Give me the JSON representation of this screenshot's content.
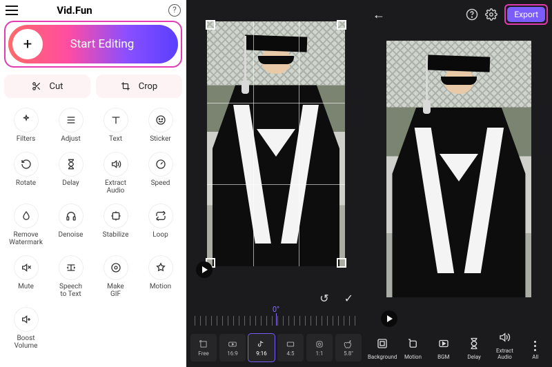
{
  "home": {
    "brand": "Vid.Fun",
    "start_label": "Start Editing",
    "cut_label": "Cut",
    "crop_label": "Crop",
    "tools": [
      {
        "id": "filters",
        "label": "Filters",
        "icon": "sparkle"
      },
      {
        "id": "adjust",
        "label": "Adjust",
        "icon": "sliders"
      },
      {
        "id": "text",
        "label": "Text",
        "icon": "text"
      },
      {
        "id": "sticker",
        "label": "Sticker",
        "icon": "smile"
      },
      {
        "id": "rotate",
        "label": "Rotate",
        "icon": "rotate"
      },
      {
        "id": "delay",
        "label": "Delay",
        "icon": "hourglass"
      },
      {
        "id": "extract_audio",
        "label": "Extract Audio",
        "icon": "audio-out"
      },
      {
        "id": "speed",
        "label": "Speed",
        "icon": "gauge"
      },
      {
        "id": "remove_watermark",
        "label": "Remove Watermark",
        "icon": "droplet"
      },
      {
        "id": "denoise",
        "label": "Denoise",
        "icon": "headphones"
      },
      {
        "id": "stabilize",
        "label": "Stabilize",
        "icon": "stabilize"
      },
      {
        "id": "loop",
        "label": "Loop",
        "icon": "loop"
      },
      {
        "id": "mute",
        "label": "Mute",
        "icon": "mute"
      },
      {
        "id": "speech_to_text",
        "label": "Speech to Text",
        "icon": "speech"
      },
      {
        "id": "make_gif",
        "label": "Make GIF",
        "icon": "gif"
      },
      {
        "id": "motion",
        "label": "Motion",
        "icon": "star"
      },
      {
        "id": "boost_volume",
        "label": "Boost Volume",
        "icon": "vol-plus"
      }
    ]
  },
  "crop_editor": {
    "angle_label": "0°",
    "ratios": [
      {
        "id": "free",
        "label": "Free",
        "icon": "free",
        "selected": false
      },
      {
        "id": "16_9",
        "label": "16:9",
        "icon": "yt",
        "selected": false
      },
      {
        "id": "9_16",
        "label": "9:16",
        "icon": "tiktok",
        "selected": true
      },
      {
        "id": "4_5",
        "label": "4:5",
        "icon": "wide",
        "selected": false
      },
      {
        "id": "1_1",
        "label": "1:1",
        "icon": "ig",
        "selected": false
      },
      {
        "id": "apple",
        "label": "5.8\"",
        "icon": "apple",
        "selected": false
      }
    ]
  },
  "export_editor": {
    "export_label": "Export",
    "tools": [
      {
        "id": "background",
        "label": "Background",
        "icon": "bg"
      },
      {
        "id": "motion",
        "label": "Motion",
        "icon": "motion"
      },
      {
        "id": "bgm",
        "label": "BGM",
        "icon": "bgm"
      },
      {
        "id": "delay",
        "label": "Delay",
        "icon": "hourglass"
      },
      {
        "id": "extract_audio",
        "label": "Extract Audio",
        "icon": "audio-out"
      },
      {
        "id": "all",
        "label": "All",
        "icon": "dots"
      }
    ]
  }
}
